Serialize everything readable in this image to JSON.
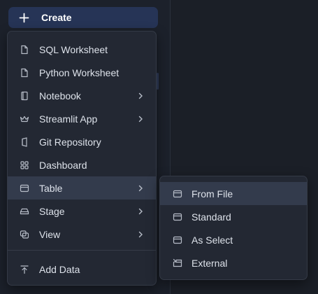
{
  "create_button": {
    "label": "Create",
    "icon": "plus-icon"
  },
  "menu": {
    "items": [
      {
        "label": "SQL Worksheet",
        "icon": "file-icon",
        "submenu": false
      },
      {
        "label": "Python Worksheet",
        "icon": "file-icon",
        "submenu": false
      },
      {
        "label": "Notebook",
        "icon": "notebook-icon",
        "submenu": true
      },
      {
        "label": "Streamlit App",
        "icon": "crown-icon",
        "submenu": true
      },
      {
        "label": "Git Repository",
        "icon": "git-repo-icon",
        "submenu": false
      },
      {
        "label": "Dashboard",
        "icon": "dashboard-icon",
        "submenu": false
      },
      {
        "label": "Table",
        "icon": "table-icon",
        "submenu": true,
        "active": true
      },
      {
        "label": "Stage",
        "icon": "stage-icon",
        "submenu": true
      },
      {
        "label": "View",
        "icon": "view-icon",
        "submenu": true
      }
    ],
    "footer_item": {
      "label": "Add Data",
      "icon": "upload-icon"
    }
  },
  "table_submenu": {
    "items": [
      {
        "label": "From File",
        "icon": "table-icon",
        "active": true
      },
      {
        "label": "Standard",
        "icon": "table-icon"
      },
      {
        "label": "As Select",
        "icon": "table-icon"
      },
      {
        "label": "External",
        "icon": "external-table-icon"
      }
    ]
  },
  "colors": {
    "background": "#1c212b",
    "menu_background": "#232833",
    "active_item": "#333b4c",
    "create_button": "#263456"
  }
}
